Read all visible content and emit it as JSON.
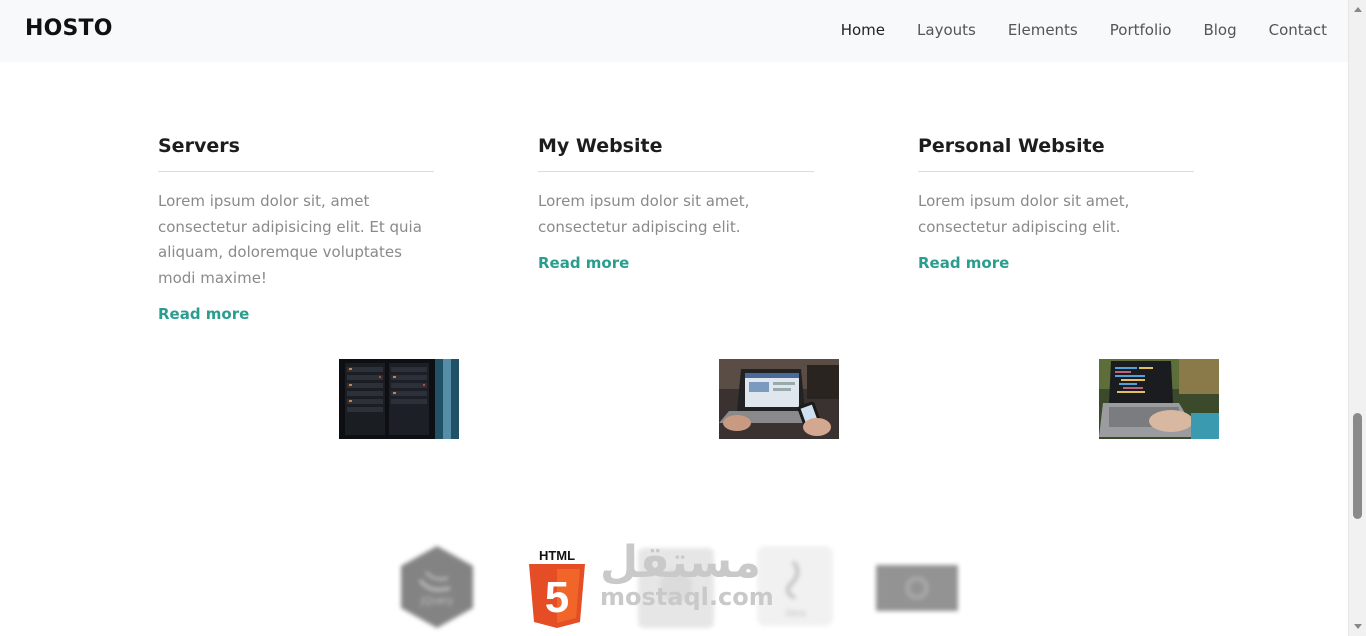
{
  "brand": "HOSTO",
  "nav": {
    "items": [
      {
        "label": "Home",
        "active": true
      },
      {
        "label": "Layouts"
      },
      {
        "label": "Elements"
      },
      {
        "label": "Portfolio"
      },
      {
        "label": "Blog"
      },
      {
        "label": "Contact"
      }
    ]
  },
  "cards": [
    {
      "title": "Servers",
      "text": "Lorem ipsum dolor sit, amet consectetur adipisicing elit. Et quia aliquam, doloremque voluptates modi maxime!",
      "link": "Read more",
      "image": "server-rack-photo"
    },
    {
      "title": "My Website",
      "text": "Lorem ipsum dolor sit amet, consectetur adipiscing elit.",
      "link": "Read more",
      "image": "laptop-phone-photo"
    },
    {
      "title": "Personal Website",
      "text": "Lorem ipsum dolor sit amet, consectetur adipiscing elit.",
      "link": "Read more",
      "image": "laptop-typing-photo"
    }
  ],
  "logos": {
    "html5_label": "HTML",
    "html5_number": "5",
    "jquery_label": "jQuery",
    "java_label": "Java"
  },
  "watermark": {
    "arabic": "مستقل",
    "latin": "mostaql.com"
  },
  "colors": {
    "link": "#2a9d8f",
    "navbar": "#f8f9fa",
    "html5": "#e44d26"
  }
}
